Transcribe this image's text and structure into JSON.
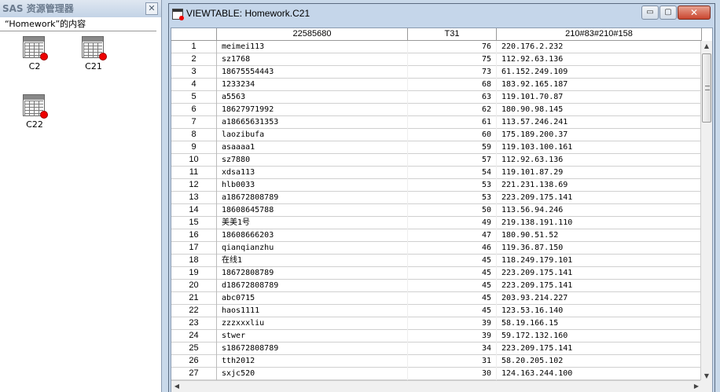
{
  "explorer": {
    "title": "SAS 资源管理器",
    "close_glyph": "✕",
    "contents_label": "“Homework”的内容",
    "datasets": [
      {
        "name": "C2",
        "icon": "dataset-table-icon"
      },
      {
        "name": "C21",
        "icon": "dataset-table-icon"
      },
      {
        "name": "C22",
        "icon": "dataset-table-icon"
      }
    ]
  },
  "viewtable": {
    "title": "VIEWTABLE: Homework.C21",
    "buttons": {
      "minimize": "▭",
      "maximize": "▢",
      "close": "✕"
    },
    "columns": [
      "",
      "22585680",
      "T31",
      "210#83#210#158"
    ],
    "rows": [
      [
        "1",
        "meimei113",
        "76",
        "220.176.2.232"
      ],
      [
        "2",
        "sz1768",
        "75",
        "112.92.63.136"
      ],
      [
        "3",
        "18675554443",
        "73",
        "61.152.249.109"
      ],
      [
        "4",
        "1233234",
        "68",
        "183.92.165.187"
      ],
      [
        "5",
        "a5563",
        "63",
        "119.101.70.87"
      ],
      [
        "6",
        "18627971992",
        "62",
        "180.90.98.145"
      ],
      [
        "7",
        "a18665631353",
        "61",
        "113.57.246.241"
      ],
      [
        "8",
        "laozibufa",
        "60",
        "175.189.200.37"
      ],
      [
        "9",
        "asaaaa1",
        "59",
        "119.103.100.161"
      ],
      [
        "10",
        "sz7880",
        "57",
        "112.92.63.136"
      ],
      [
        "11",
        "xdsa113",
        "54",
        "119.101.87.29"
      ],
      [
        "12",
        "hlb0033",
        "53",
        "221.231.138.69"
      ],
      [
        "13",
        "a18672808789",
        "53",
        "223.209.175.141"
      ],
      [
        "14",
        "18608645788",
        "50",
        "113.56.94.246"
      ],
      [
        "15",
        "美美1号",
        "49",
        "219.138.191.110"
      ],
      [
        "16",
        "18608666203",
        "47",
        "180.90.51.52"
      ],
      [
        "17",
        "qianqianzhu",
        "46",
        "119.36.87.150"
      ],
      [
        "18",
        "在线1",
        "45",
        "118.249.179.101"
      ],
      [
        "19",
        "18672808789",
        "45",
        "223.209.175.141"
      ],
      [
        "20",
        "d18672808789",
        "45",
        "223.209.175.141"
      ],
      [
        "21",
        "abc0715",
        "45",
        "203.93.214.227"
      ],
      [
        "22",
        "haos1111",
        "45",
        "123.53.16.140"
      ],
      [
        "23",
        "zzzxxxliu",
        "39",
        "58.19.166.15"
      ],
      [
        "24",
        "stwer",
        "39",
        "59.172.132.160"
      ],
      [
        "25",
        "s18672808789",
        "34",
        "223.209.175.141"
      ],
      [
        "26",
        "tth2012",
        "31",
        "58.20.205.102"
      ],
      [
        "27",
        "sxjc520",
        "30",
        "124.163.244.100"
      ]
    ]
  }
}
